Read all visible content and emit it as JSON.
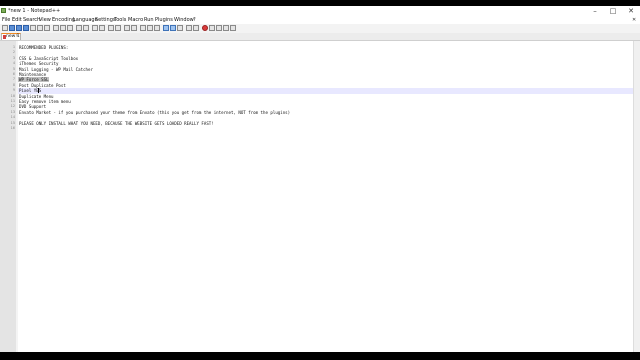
{
  "window": {
    "title": "*new 1 - Notepad++",
    "controls": [
      "–",
      "□",
      "✕"
    ]
  },
  "menu": [
    "File",
    "Edit",
    "Search",
    "View",
    "Encoding",
    "Language",
    "Settings",
    "Tools",
    "Macro",
    "Run",
    "Plugins",
    "Window",
    "?"
  ],
  "tab": {
    "label": "new 1",
    "close": "✕"
  },
  "editor": {
    "lines": [
      "RECOMMENDED PLUGINS:",
      "",
      "CSS & JavaScript Toolbox",
      "iThemes Security",
      "Mail Logging - WP Mail Catcher",
      "Maintenance",
      "WP Force SSL",
      "Post Duplicate Post",
      "Pixel YES",
      "Duplicate Menu",
      "Easy remove item menu",
      "DVD Support",
      "Envato Market - if you purchased your theme from Envato (this you get from the internet, NOT from the plugins)",
      "",
      "PLEASE ONLY INSTALL WHAT YOU NEED, BECAUSE THE WEBSITE GETS LOADED REALLY FAST!",
      ""
    ],
    "current_line": 8,
    "selected_line": 7
  },
  "icons": {
    "app": "notepadpp-icon",
    "toolbar": [
      "new-file-icon",
      "open-file-icon",
      "save-icon",
      "save-all-icon",
      "close-icon",
      "close-all-icon",
      "print-icon",
      "cut-icon",
      "copy-icon",
      "paste-icon",
      "undo-icon",
      "redo-icon",
      "find-icon",
      "replace-icon",
      "zoom-in-icon",
      "zoom-out-icon",
      "sync-v-icon",
      "sync-h-icon",
      "word-wrap-icon",
      "show-all-icon",
      "indent-guide-icon",
      "udl-icon",
      "doc-map-icon",
      "function-list-icon",
      "folder-workspace-icon",
      "monitor-icon",
      "record-macro-icon",
      "stop-macro-icon",
      "play-macro-icon",
      "run-macro-icon",
      "save-macro-icon"
    ]
  }
}
